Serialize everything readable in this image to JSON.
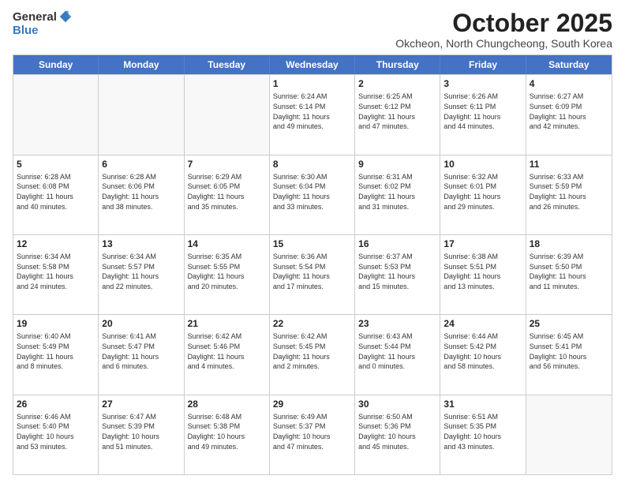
{
  "logo": {
    "general": "General",
    "blue": "Blue"
  },
  "title": "October 2025",
  "subtitle": "Okcheon, North Chungcheong, South Korea",
  "days": [
    "Sunday",
    "Monday",
    "Tuesday",
    "Wednesday",
    "Thursday",
    "Friday",
    "Saturday"
  ],
  "weeks": [
    [
      {
        "date": "",
        "info": ""
      },
      {
        "date": "",
        "info": ""
      },
      {
        "date": "",
        "info": ""
      },
      {
        "date": "1",
        "info": "Sunrise: 6:24 AM\nSunset: 6:14 PM\nDaylight: 11 hours\nand 49 minutes."
      },
      {
        "date": "2",
        "info": "Sunrise: 6:25 AM\nSunset: 6:12 PM\nDaylight: 11 hours\nand 47 minutes."
      },
      {
        "date": "3",
        "info": "Sunrise: 6:26 AM\nSunset: 6:11 PM\nDaylight: 11 hours\nand 44 minutes."
      },
      {
        "date": "4",
        "info": "Sunrise: 6:27 AM\nSunset: 6:09 PM\nDaylight: 11 hours\nand 42 minutes."
      }
    ],
    [
      {
        "date": "5",
        "info": "Sunrise: 6:28 AM\nSunset: 6:08 PM\nDaylight: 11 hours\nand 40 minutes."
      },
      {
        "date": "6",
        "info": "Sunrise: 6:28 AM\nSunset: 6:06 PM\nDaylight: 11 hours\nand 38 minutes."
      },
      {
        "date": "7",
        "info": "Sunrise: 6:29 AM\nSunset: 6:05 PM\nDaylight: 11 hours\nand 35 minutes."
      },
      {
        "date": "8",
        "info": "Sunrise: 6:30 AM\nSunset: 6:04 PM\nDaylight: 11 hours\nand 33 minutes."
      },
      {
        "date": "9",
        "info": "Sunrise: 6:31 AM\nSunset: 6:02 PM\nDaylight: 11 hours\nand 31 minutes."
      },
      {
        "date": "10",
        "info": "Sunrise: 6:32 AM\nSunset: 6:01 PM\nDaylight: 11 hours\nand 29 minutes."
      },
      {
        "date": "11",
        "info": "Sunrise: 6:33 AM\nSunset: 5:59 PM\nDaylight: 11 hours\nand 26 minutes."
      }
    ],
    [
      {
        "date": "12",
        "info": "Sunrise: 6:34 AM\nSunset: 5:58 PM\nDaylight: 11 hours\nand 24 minutes."
      },
      {
        "date": "13",
        "info": "Sunrise: 6:34 AM\nSunset: 5:57 PM\nDaylight: 11 hours\nand 22 minutes."
      },
      {
        "date": "14",
        "info": "Sunrise: 6:35 AM\nSunset: 5:55 PM\nDaylight: 11 hours\nand 20 minutes."
      },
      {
        "date": "15",
        "info": "Sunrise: 6:36 AM\nSunset: 5:54 PM\nDaylight: 11 hours\nand 17 minutes."
      },
      {
        "date": "16",
        "info": "Sunrise: 6:37 AM\nSunset: 5:53 PM\nDaylight: 11 hours\nand 15 minutes."
      },
      {
        "date": "17",
        "info": "Sunrise: 6:38 AM\nSunset: 5:51 PM\nDaylight: 11 hours\nand 13 minutes."
      },
      {
        "date": "18",
        "info": "Sunrise: 6:39 AM\nSunset: 5:50 PM\nDaylight: 11 hours\nand 11 minutes."
      }
    ],
    [
      {
        "date": "19",
        "info": "Sunrise: 6:40 AM\nSunset: 5:49 PM\nDaylight: 11 hours\nand 8 minutes."
      },
      {
        "date": "20",
        "info": "Sunrise: 6:41 AM\nSunset: 5:47 PM\nDaylight: 11 hours\nand 6 minutes."
      },
      {
        "date": "21",
        "info": "Sunrise: 6:42 AM\nSunset: 5:46 PM\nDaylight: 11 hours\nand 4 minutes."
      },
      {
        "date": "22",
        "info": "Sunrise: 6:42 AM\nSunset: 5:45 PM\nDaylight: 11 hours\nand 2 minutes."
      },
      {
        "date": "23",
        "info": "Sunrise: 6:43 AM\nSunset: 5:44 PM\nDaylight: 11 hours\nand 0 minutes."
      },
      {
        "date": "24",
        "info": "Sunrise: 6:44 AM\nSunset: 5:42 PM\nDaylight: 10 hours\nand 58 minutes."
      },
      {
        "date": "25",
        "info": "Sunrise: 6:45 AM\nSunset: 5:41 PM\nDaylight: 10 hours\nand 56 minutes."
      }
    ],
    [
      {
        "date": "26",
        "info": "Sunrise: 6:46 AM\nSunset: 5:40 PM\nDaylight: 10 hours\nand 53 minutes."
      },
      {
        "date": "27",
        "info": "Sunrise: 6:47 AM\nSunset: 5:39 PM\nDaylight: 10 hours\nand 51 minutes."
      },
      {
        "date": "28",
        "info": "Sunrise: 6:48 AM\nSunset: 5:38 PM\nDaylight: 10 hours\nand 49 minutes."
      },
      {
        "date": "29",
        "info": "Sunrise: 6:49 AM\nSunset: 5:37 PM\nDaylight: 10 hours\nand 47 minutes."
      },
      {
        "date": "30",
        "info": "Sunrise: 6:50 AM\nSunset: 5:36 PM\nDaylight: 10 hours\nand 45 minutes."
      },
      {
        "date": "31",
        "info": "Sunrise: 6:51 AM\nSunset: 5:35 PM\nDaylight: 10 hours\nand 43 minutes."
      },
      {
        "date": "",
        "info": ""
      }
    ]
  ]
}
